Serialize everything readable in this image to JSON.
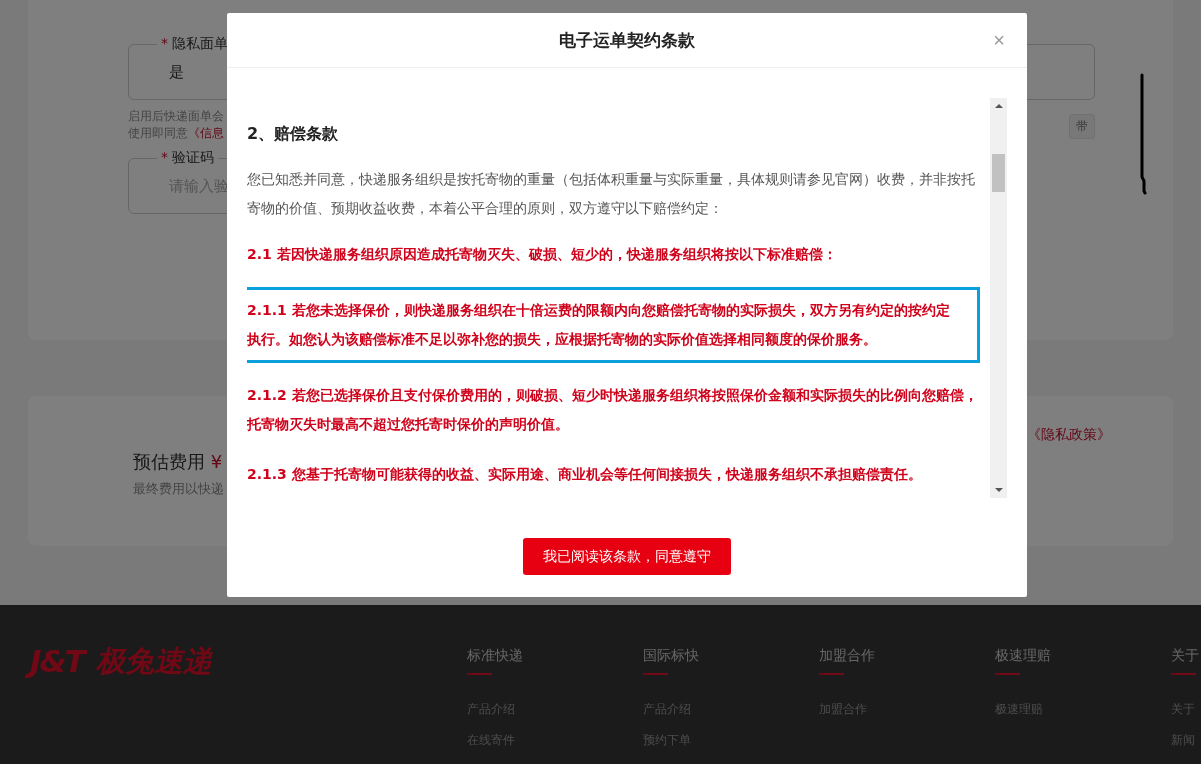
{
  "background_form": {
    "fields": [
      {
        "label": "隐私面单",
        "mark": "*",
        "value": "是"
      },
      {
        "label": "验证码",
        "mark": "*",
        "placeholder": "请输入验"
      }
    ],
    "hint_lines": [
      {
        "text": "启用后快递面单会"
      },
      {
        "text": "使用即同意",
        "link": "《信息"
      }
    ],
    "tag": "带"
  },
  "estimate": {
    "label": "预估费用",
    "currency": "¥",
    "note": "最终费用以快递",
    "policy_link": "《隐私政策》"
  },
  "modal": {
    "title": "电子运单契约条款",
    "close": "×",
    "sections": [
      {
        "kind": "heading",
        "text": "2、赔偿条款"
      },
      {
        "kind": "body",
        "text": "您已知悉并同意，快递服务组织是按托寄物的重量（包括体积重量与实际重量，具体规则请参见官网）收费，并非按托寄物的价值、预期收益收费，本着公平合理的原则，双方遵守以下赔偿约定："
      },
      {
        "kind": "clause",
        "text": "2.1 若因快递服务组织原因造成托寄物灭失、破损、短少的，快递服务组织将按以下标准赔偿：",
        "highlighted": false
      },
      {
        "kind": "clause",
        "text": "2.1.1 若您未选择保价，则快递服务组织在十倍运费的限额内向您赔偿托寄物的实际损失，双方另有约定的按约定执行。如您认为该赔偿标准不足以弥补您的损失，应根据托寄物的实际价值选择相同额度的保价服务。",
        "highlighted": true
      },
      {
        "kind": "clause",
        "text": "2.1.2 若您已选择保价且支付保价费用的，则破损、短少时快递服务组织将按照保价金额和实际损失的比例向您赔偿，托寄物灭失时最高不超过您托寄时保价的声明价值。",
        "highlighted": false
      },
      {
        "kind": "clause",
        "text": "2.1.3 您基于托寄物可能获得的收益、实际用途、商业机会等任何间接损失，快递服务组织不承担赔偿责任。",
        "highlighted": false
      }
    ],
    "confirm_button": "我已阅读该条款，同意遵守"
  },
  "footer": {
    "logo_mark": "J&T",
    "logo_text": "极兔速递",
    "columns": [
      {
        "title": "标准快递",
        "links": [
          "产品介绍",
          "在线寄件"
        ]
      },
      {
        "title": "国际标快",
        "links": [
          "产品介绍",
          "预约下单"
        ]
      },
      {
        "title": "加盟合作",
        "links": [
          "加盟合作"
        ]
      },
      {
        "title": "极速理赔",
        "links": [
          "极速理赔"
        ]
      },
      {
        "title": "关于",
        "links": [
          "关于",
          "新闻"
        ]
      }
    ]
  }
}
